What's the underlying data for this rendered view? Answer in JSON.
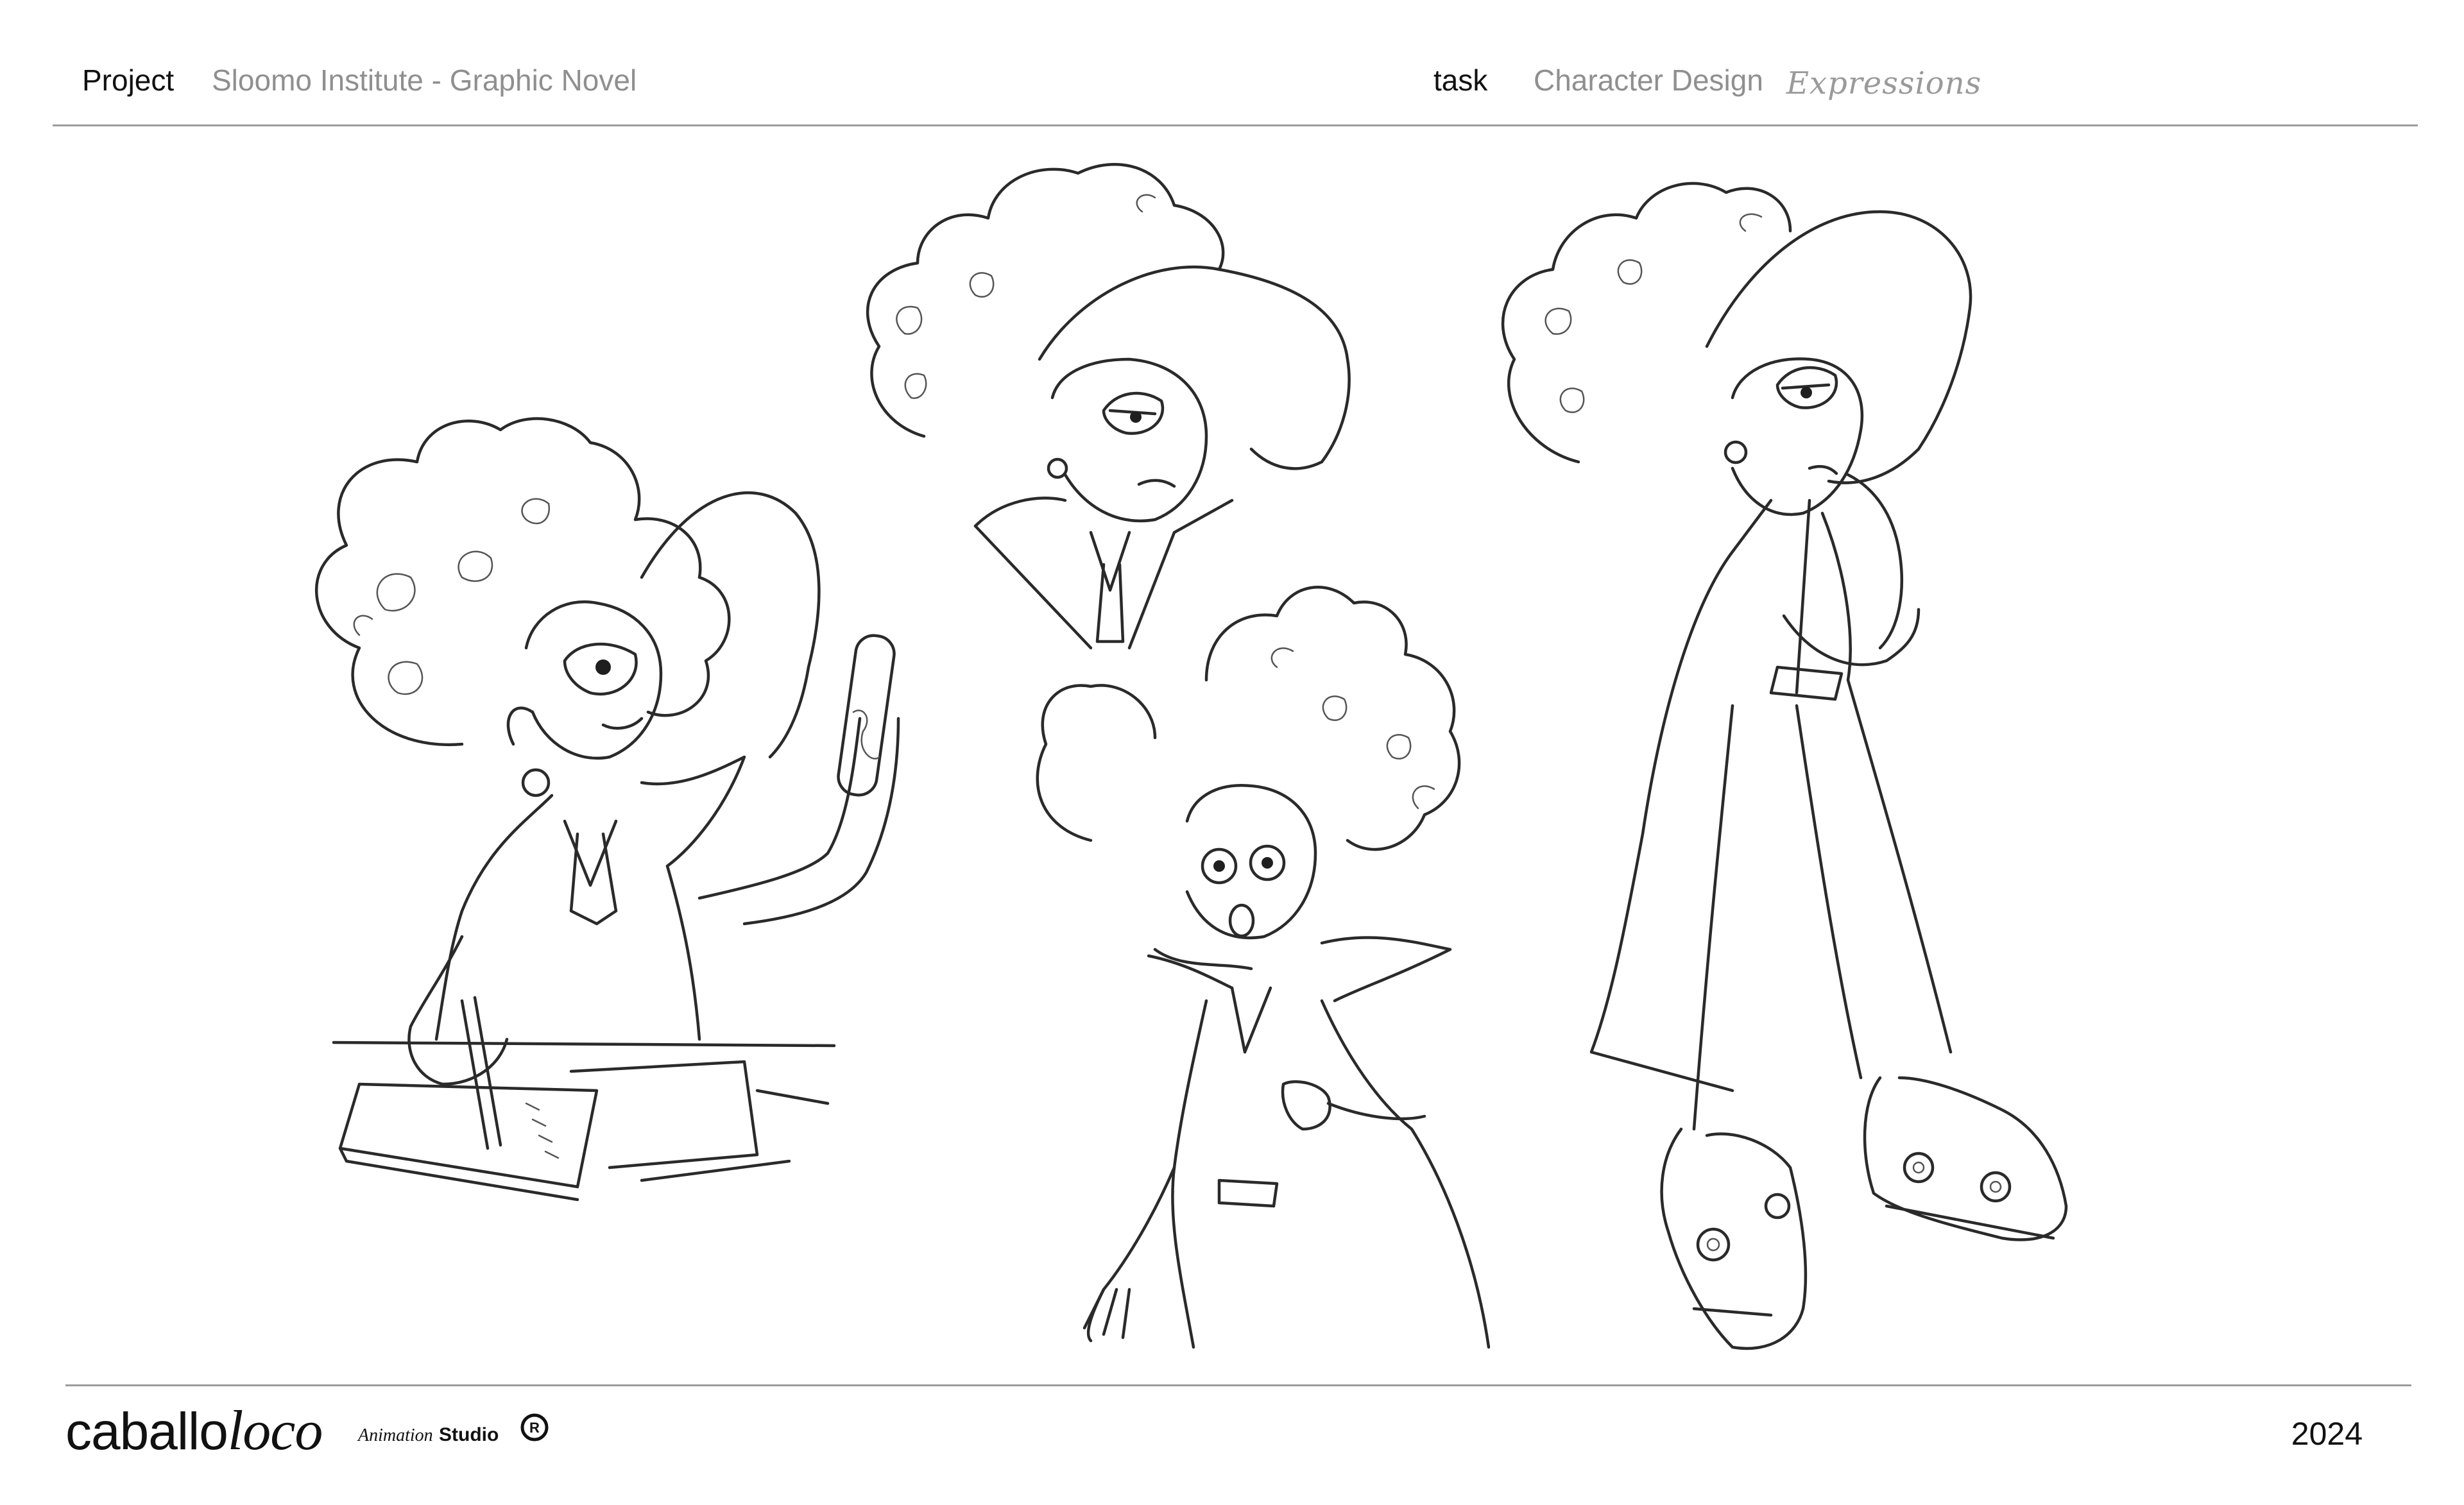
{
  "header": {
    "project_label": "Project",
    "project_value": "Sloomo Institute - Graphic Novel",
    "task_label": "task",
    "task_value": "Character Design",
    "task_note": "Expressions"
  },
  "footer": {
    "brand_prefix": "caballo",
    "brand_suffix": "loco",
    "brand_animation": "Animation",
    "brand_studio": "Studio",
    "registered_mark": "R",
    "year": "2024"
  },
  "sketches": [
    {
      "pose": "seated-writing-holding-vial"
    },
    {
      "pose": "bust-annoyed"
    },
    {
      "pose": "half-body-shocked"
    },
    {
      "pose": "full-body-thinking"
    }
  ],
  "colors": {
    "line": "#2a2a2a",
    "rule": "#9c9c9c",
    "muted_text": "#8f8f8f"
  }
}
